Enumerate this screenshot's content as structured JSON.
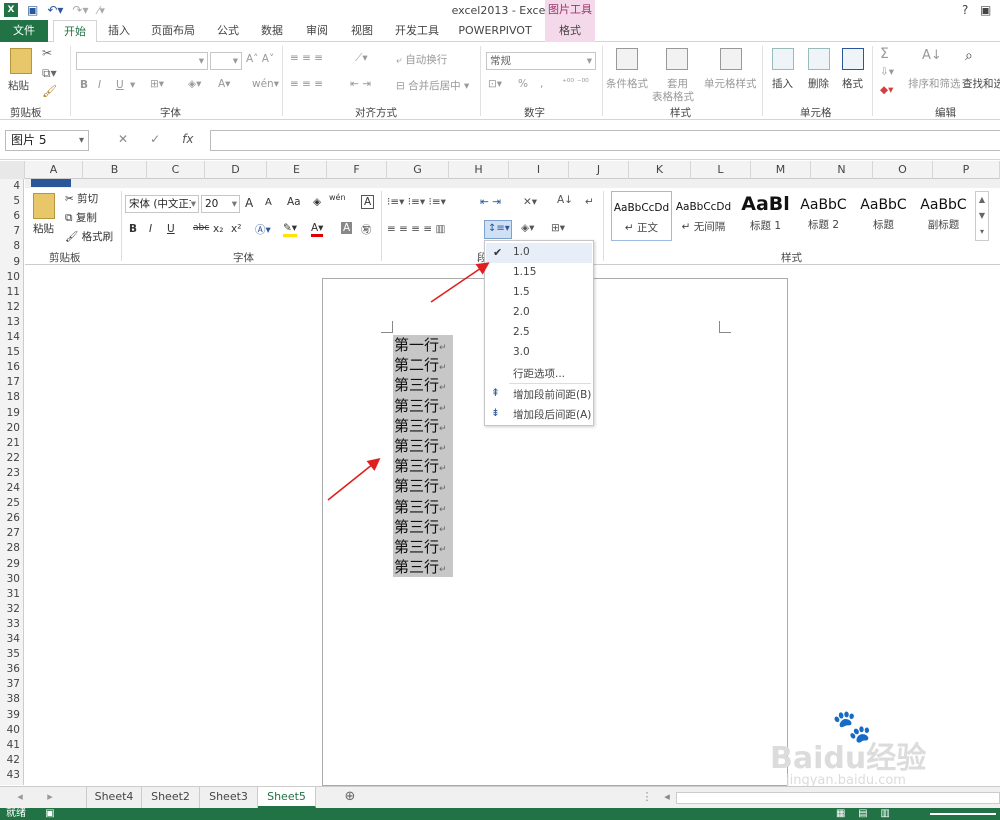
{
  "window": {
    "title": "excel2013 - Excel",
    "picture_tools": "图片工具",
    "help": "?"
  },
  "tabs": [
    "文件",
    "开始",
    "插入",
    "页面布局",
    "公式",
    "数据",
    "审阅",
    "视图",
    "开发工具",
    "POWERPIVOT",
    "格式"
  ],
  "ribbon": {
    "clipboard": {
      "paste": "粘贴",
      "label": "剪贴板"
    },
    "font": {
      "label": "字体",
      "bold": "B",
      "italic": "I",
      "underline": "U"
    },
    "alignment": {
      "wrap": "自动换行",
      "merge": "合并后居中",
      "label": "对齐方式"
    },
    "number": {
      "format": "常规",
      "percent": "%",
      "comma": ",",
      "label": "数字"
    },
    "styles": {
      "cond": "条件格式",
      "table1": "套用",
      "table2": "表格格式",
      "cell": "单元格样式",
      "label": "样式"
    },
    "cells": {
      "insert": "插入",
      "delete": "删除",
      "format": "格式",
      "label": "单元格"
    },
    "editing": {
      "sigma": "Σ",
      "sort": "排序和筛选",
      "find": "查找和选",
      "label": "编辑"
    }
  },
  "formula_bar": {
    "name_box": "图片 5",
    "cancel": "✕",
    "enter": "✓",
    "fx": "fx"
  },
  "columns": [
    "A",
    "B",
    "C",
    "D",
    "E",
    "F",
    "G",
    "H",
    "I",
    "J",
    "K",
    "L",
    "M",
    "N",
    "O",
    "P"
  ],
  "rows": [
    "4",
    "5",
    "6",
    "7",
    "8",
    "9",
    "10",
    "11",
    "12",
    "13",
    "14",
    "15",
    "16",
    "17",
    "18",
    "19",
    "20",
    "21",
    "22",
    "23",
    "24",
    "25",
    "26",
    "27",
    "28",
    "29",
    "30",
    "31",
    "32",
    "33",
    "34",
    "35",
    "36",
    "37",
    "38",
    "39",
    "40",
    "41",
    "42",
    "43"
  ],
  "word": {
    "clipboard": {
      "paste": "粘贴",
      "cut": "剪切",
      "copy": "复制",
      "painter": "格式刷",
      "label": "剪贴板"
    },
    "font": {
      "name": "宋体 (中文正文",
      "size": "20",
      "grow": "A",
      "shrink": "A",
      "aa": "Aa",
      "wen": "wén",
      "label": "字体",
      "b": "B",
      "i": "I",
      "u": "U",
      "abc": "abc",
      "sub": "x₂",
      "sup": "x²"
    },
    "para": {
      "label": "段"
    },
    "styles": {
      "label": "样式",
      "items": [
        {
          "preview": "AaBbCcDd",
          "name": "↵ 正文"
        },
        {
          "preview": "AaBbCcDd",
          "name": "↵ 无间隔"
        },
        {
          "preview": "AaBl",
          "name": "标题 1"
        },
        {
          "preview": "AaBbC",
          "name": "标题 2"
        },
        {
          "preview": "AaBbC",
          "name": "标题"
        },
        {
          "preview": "AaBbC",
          "name": "副标题"
        }
      ]
    }
  },
  "document": {
    "lines": [
      "第一行",
      "第二行",
      "第三行",
      "第三行",
      "第三行",
      "第三行",
      "第三行",
      "第三行",
      "第三行",
      "第三行",
      "第三行",
      "第三行"
    ],
    "para_mark": "↵"
  },
  "line_spacing_menu": {
    "options": [
      "1.0",
      "1.15",
      "1.5",
      "2.0",
      "2.5",
      "3.0"
    ],
    "selected": "1.0",
    "more": "行距选项...",
    "before": "增加段前间距(B)",
    "after": "增加段后间距(A)"
  },
  "sheet_tabs": [
    "Sheet4",
    "Sheet2",
    "Sheet3",
    "Sheet5"
  ],
  "active_sheet": "Sheet5",
  "status": {
    "ready": "就绪"
  },
  "watermark": {
    "brand": "Baidu经验",
    "url": "jingyan.baidu.com"
  }
}
